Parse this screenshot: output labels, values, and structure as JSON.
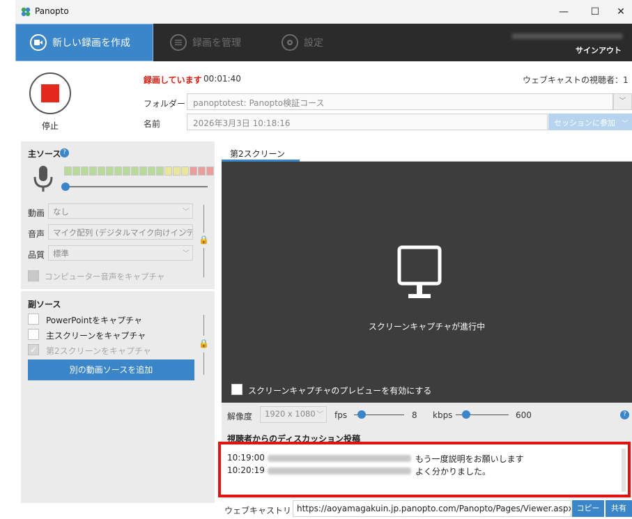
{
  "window": {
    "title": "Panopto",
    "minimize": "—",
    "maximize": "☐",
    "close": "✕"
  },
  "nav": {
    "tabs": [
      {
        "label": "新しい録画を作成"
      },
      {
        "label": "録画を管理"
      },
      {
        "label": "設定"
      }
    ],
    "signout": "サインアウト"
  },
  "recording": {
    "stop_label": "停止",
    "status": "録画しています",
    "time": "00:01:40",
    "viewers": "ウェブキャストの視聴者：1",
    "folder_label": "フォルダー",
    "folder_value": "panoptotest: Panopto検証コース",
    "name_label": "名前",
    "name_value": "2026年3月3日 10:18:16",
    "session_button": "セッションに参加"
  },
  "primary": {
    "title": "主ソース",
    "video_label": "動画",
    "video_value": "なし",
    "audio_label": "音声",
    "audio_value": "マイク配列 (デジタルマイク向けインテ",
    "quality_label": "品質",
    "quality_value": "標準",
    "capture_system_audio": "コンピューター音声をキャプチャ",
    "level_colors": [
      "#8fcf5d",
      "#8fcf5d",
      "#8fcf5d",
      "#8fcf5d",
      "#8fcf5d",
      "#8fcf5d",
      "#8fcf5d",
      "#8fcf5d",
      "#8fcf5d",
      "#8fcf5d",
      "#8fcf5d",
      "#8fcf5d",
      "#e8e45c",
      "#e8e45c",
      "#e8e45c",
      "#e86060",
      "#e86060",
      "#e86060"
    ]
  },
  "secondary": {
    "title": "副ソース",
    "capture_powerpoint": "PowerPointをキャプチャ",
    "capture_main_screen": "主スクリーンをキャプチャ",
    "capture_second_screen": "第2スクリーンをキャプチャ",
    "check_mark": "✓",
    "add_source_button": "別の動画ソースを追加"
  },
  "screen": {
    "tab_label": "第2スクリーン",
    "capture_status": "スクリーンキャプチャが進行中",
    "enable_preview": "スクリーンキャプチャのプレビューを有効にする",
    "resolution_label": "解像度",
    "resolution_value": "1920 x 1080",
    "fps_label": "fps",
    "fps_value": "8",
    "kbps_label": "kbps",
    "kbps_value": "600"
  },
  "discussion": {
    "title": "視聴者からのディスカッション投稿",
    "messages": [
      {
        "time": "10:19:00",
        "text": "もう一度説明をお願いします"
      },
      {
        "time": "10:20:19",
        "text": "よく分かりました。"
      }
    ]
  },
  "webcast": {
    "link_label": "ウェブキャストリンク",
    "link_value": "https://aoyamagakuin.jp.panopto.com/Panopto/Pages/Viewer.aspx?",
    "copy_button": "コピー",
    "share_button": "共有"
  },
  "icons": {
    "help": "?",
    "lock": "🔒",
    "chevron": "﹀"
  },
  "colors": {
    "accent": "#3a86c8",
    "record_red": "#e5281e",
    "status_red": "#d91f11",
    "highlight_red": "#e11212"
  }
}
